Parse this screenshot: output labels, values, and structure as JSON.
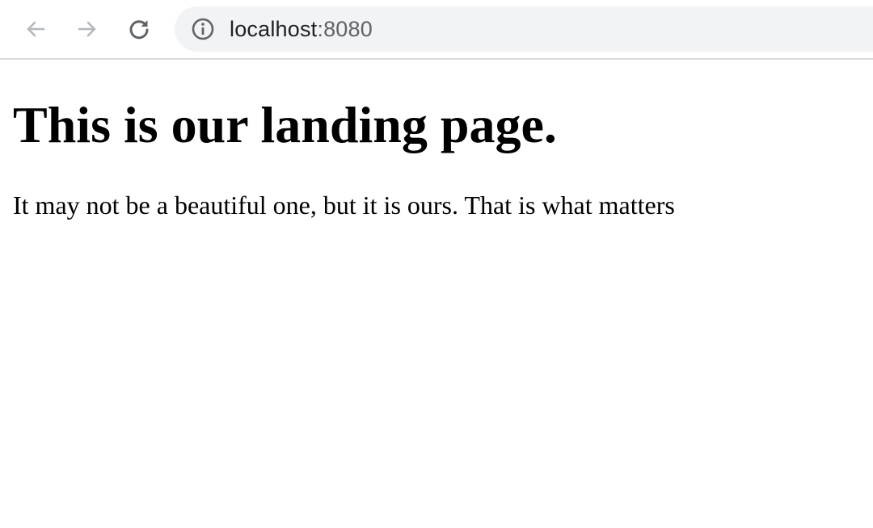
{
  "browser": {
    "address_bar": {
      "host": "localhost",
      "port": ":8080"
    },
    "icons": {
      "back": "back-arrow-icon",
      "forward": "forward-arrow-icon",
      "reload": "reload-icon",
      "site_info": "info-icon"
    },
    "colors": {
      "toolbar_border": "#dadce0",
      "omnibox_background": "#f1f3f4",
      "disabled_icon": "#9aa0a6",
      "active_icon": "#5f6368"
    }
  },
  "page": {
    "heading": "This is our landing page.",
    "paragraph": "It may not be a beautiful one, but it is ours. That is what matters"
  }
}
